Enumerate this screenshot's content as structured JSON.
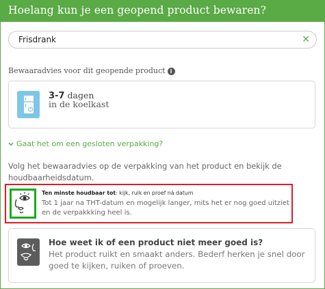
{
  "header": {
    "title": "Hoelang kun je een geopend product bewaren?"
  },
  "search": {
    "value": "Frisdrank",
    "clear_icon": "✕"
  },
  "advice": {
    "title": "Bewaaradvies voor dit geopende product",
    "info_icon": "i",
    "days": "3-7",
    "days_unit": "dagen",
    "location": "in de koelkast",
    "icon": "fridge-icon",
    "icon_color": "#7ec6e6"
  },
  "closed_packaging": {
    "toggle_label": "Gaat het om een gesloten verpakking?",
    "text": "Volg het bewaaradvies op de verpakking van het product en bekijk de houdbaarheidsdatum."
  },
  "tht": {
    "heading_bold": "Ten minste houdbaar tot",
    "heading_rest": ": kijk, ruik en proef ná datum",
    "body": "Tot 1 jaar na THT-datum en mogelijk langer, mits het er nog goed uitziet en de verpakkking heel is.",
    "icon": "face-senses-icon"
  },
  "spoiled": {
    "title": "Hoe weet ik of een product niet meer goed is?",
    "body": "Het product ruikt en smaakt anders. Bederf herken je snel door goed te kijken, ruiken of proeven.",
    "icon": "senses-icon"
  },
  "colors": {
    "brand_green": "#5aaa46",
    "highlight_red": "#e11b22",
    "highlight_green": "#1aab1a"
  }
}
